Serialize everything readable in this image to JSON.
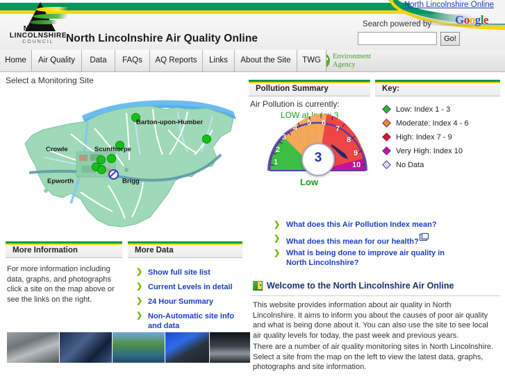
{
  "header": {
    "site_title": "North Lincolnshire Air Quality Online",
    "nlo_link": "North Lincolnshire Online",
    "search_label": "Search powered by",
    "search_value": "",
    "search_placeholder": "",
    "go_label": "Go!",
    "logo": {
      "line1": "NORTH",
      "line2": "LINCOLNSHIRE",
      "line3": "COUNCIL"
    },
    "google": {
      "g1": "G",
      "o1": "o",
      "o2": "o",
      "g2": "g",
      "l": "l",
      "e": "e"
    },
    "environment_agency": {
      "line1": "Environment",
      "line2": "Agency"
    }
  },
  "nav": {
    "tabs": [
      {
        "label": "Home",
        "active": true
      },
      {
        "label": "Air Quality",
        "active": false
      },
      {
        "label": "Data",
        "active": false
      },
      {
        "label": "FAQs",
        "active": false
      },
      {
        "label": "AQ Reports",
        "active": false
      },
      {
        "label": "Links",
        "active": false
      },
      {
        "label": "About the Site",
        "active": false
      },
      {
        "label": "TWG",
        "active": false
      }
    ]
  },
  "map": {
    "title": "Select a Monitoring Site",
    "labels": [
      {
        "text": "Barton-upon-Humber"
      },
      {
        "text": "Crowle"
      },
      {
        "text": "Scunthorpe"
      },
      {
        "text": "Epworth"
      },
      {
        "text": "Brigg"
      }
    ],
    "markers_status": "green",
    "nodata_status": "no-data"
  },
  "pollution": {
    "panel_title": "Pollution Summary",
    "status_line": "Air Pollution is currently:",
    "status_value": "LOW at Index 3",
    "gauge_value": "3",
    "gauge_band_label": "Low",
    "segments": [
      {
        "number": "1",
        "color": "#3cbf42"
      },
      {
        "number": "2",
        "color": "#3cbf42"
      },
      {
        "number": "3",
        "color": "#3cbf42"
      },
      {
        "number": "4",
        "color": "#f5a85a"
      },
      {
        "number": "5",
        "color": "#f5a85a"
      },
      {
        "number": "6",
        "color": "#f5a85a"
      },
      {
        "number": "7",
        "color": "#f04545"
      },
      {
        "number": "8",
        "color": "#f04545"
      },
      {
        "number": "9",
        "color": "#f04545"
      },
      {
        "number": "10",
        "color": "#c4129b"
      }
    ]
  },
  "key": {
    "panel_title": "Key:",
    "items": [
      {
        "label": "Low: Index 1 - 3",
        "color": "#19c219"
      },
      {
        "label": "Moderate: Index 4 - 6",
        "color": "#f29010"
      },
      {
        "label": "High: Index 7 - 9",
        "color": "#e01515"
      },
      {
        "label": "Very High: Index 10",
        "color": "#c4129b"
      },
      {
        "label": "No Data",
        "color": "#cfe0f5"
      }
    ]
  },
  "info_links": [
    {
      "label": "What does this Air Pollution Index mean?",
      "new_window": false
    },
    {
      "label": "What does this mean for our health?",
      "new_window": true
    },
    {
      "label": "What is being done to improve air quality in North Lincolnshire?",
      "new_window": false
    }
  ],
  "welcome": {
    "title": "Welcome to the North Lincolnshire Air Online",
    "paragraphs": [
      "This website provides information about air quality in North Lincolnshire. It aims to inform you about the causes of poor air quality and what is being done about it. You can also use the site to see local air quality levels for today, the past week and previous years.",
      "There are a number of air quality monitoring sites in North Lincolnshire. Select a site from the map on the left to view the latest data, graphs, photographs and site information."
    ]
  },
  "more_information": {
    "panel_title": "More Information",
    "body": "For more information including data, graphs, and photographs click a site on the map above or see the links on the right."
  },
  "more_data": {
    "panel_title": "More Data",
    "links": [
      "Show full site list",
      "Current Levels in detail",
      "24 Hour Summary",
      "Non-Automatic site info and data"
    ]
  },
  "photos": [
    {
      "caption": "motorway-traffic"
    },
    {
      "caption": "industrial-pipes"
    },
    {
      "caption": "canal-river"
    },
    {
      "caption": "cooling-towers"
    },
    {
      "caption": "industrial-interior"
    }
  ]
}
